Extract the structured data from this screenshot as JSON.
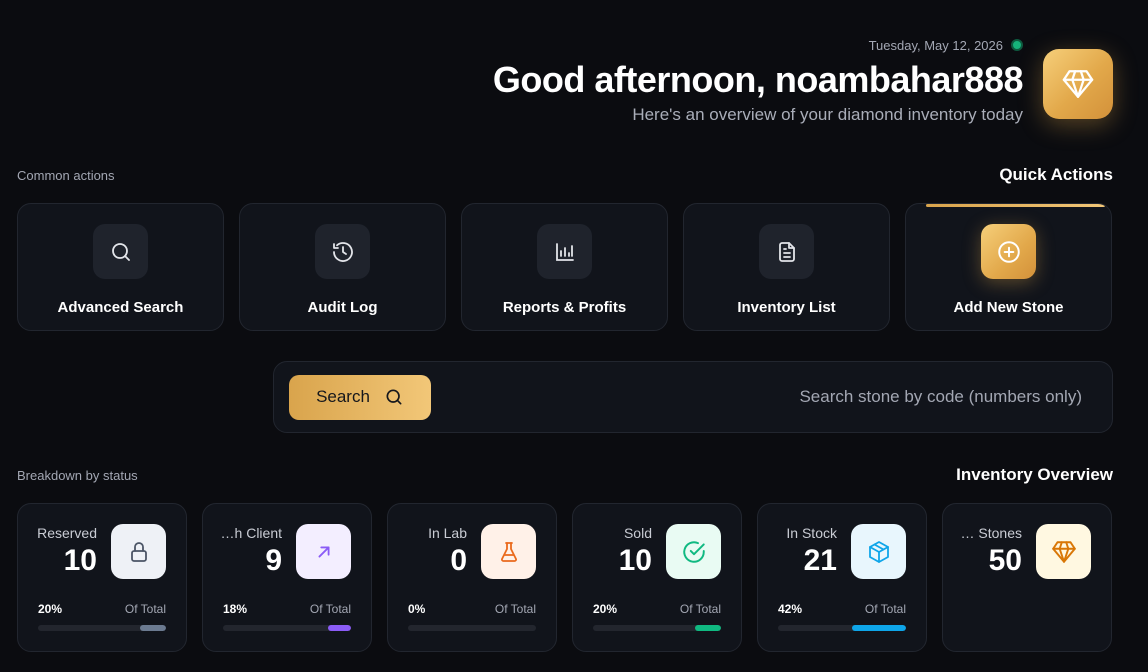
{
  "header": {
    "date": "Tuesday, May 12, 2026",
    "greeting": "Good afternoon, noambahar888",
    "subtitle": "Here's an overview of your diamond inventory today",
    "logo_icon": "diamond-icon"
  },
  "quick_actions": {
    "label": "Common actions",
    "title": "Quick Actions",
    "items": [
      {
        "label": "Advanced Search",
        "icon": "search-icon"
      },
      {
        "label": "Audit Log",
        "icon": "history-icon"
      },
      {
        "label": "Reports & Profits",
        "icon": "bar-chart-icon"
      },
      {
        "label": "Inventory List",
        "icon": "document-icon"
      },
      {
        "label": "Add New Stone",
        "icon": "plus-circle-icon"
      }
    ]
  },
  "search": {
    "button_label": "Search",
    "placeholder": "Search stone by code (numbers only)",
    "value": ""
  },
  "overview": {
    "label": "Breakdown by status",
    "title": "Inventory Overview",
    "stats": [
      {
        "label": "Reserved",
        "value": "10",
        "percent": "20%",
        "percent_value": 20,
        "of_total": "Of Total",
        "icon": "lock-icon",
        "color": "#6b7a90"
      },
      {
        "label": "…h Client",
        "value": "9",
        "percent": "18%",
        "percent_value": 18,
        "of_total": "Of Total",
        "icon": "arrow-up-right-icon",
        "color": "#8b5cf6"
      },
      {
        "label": "In Lab",
        "value": "0",
        "percent": "0%",
        "percent_value": 0,
        "of_total": "Of Total",
        "icon": "flask-icon",
        "color": "#ea6a1c"
      },
      {
        "label": "Sold",
        "value": "10",
        "percent": "20%",
        "percent_value": 20,
        "of_total": "Of Total",
        "icon": "check-circle-icon",
        "color": "#10b981"
      },
      {
        "label": "In Stock",
        "value": "21",
        "percent": "42%",
        "percent_value": 42,
        "of_total": "Of Total",
        "icon": "box-icon",
        "color": "#0ea5e9"
      },
      {
        "label": "… Stones",
        "value": "50",
        "icon": "gem-icon",
        "color": "#d97706"
      }
    ]
  },
  "colors": {
    "accent_gold": "#e2a84a",
    "background": "#0b0c10",
    "card": "#11141b"
  }
}
